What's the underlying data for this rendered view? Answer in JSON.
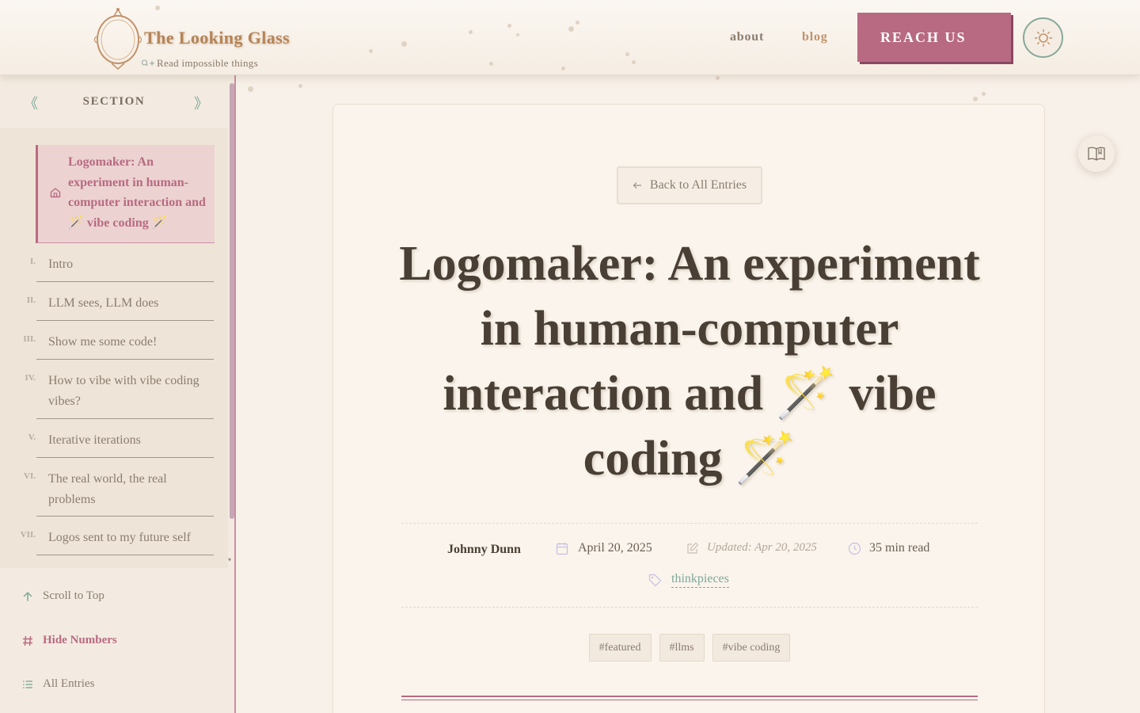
{
  "header": {
    "site_title": "The Looking Glass",
    "tagline": "Read impossible things",
    "nav": [
      {
        "label": "about"
      },
      {
        "label": "blog"
      }
    ],
    "cta_label": "REACH US"
  },
  "sidebar": {
    "title": "SECTION",
    "prev_glyph": "《",
    "next_glyph": "》",
    "active_item": "Logomaker: An experiment in human-computer interaction and 🪄 vibe coding 🪄",
    "toc": [
      {
        "num": "I.",
        "label": "Intro"
      },
      {
        "num": "II.",
        "label": "LLM sees, LLM does"
      },
      {
        "num": "III.",
        "label": "Show me some code!"
      },
      {
        "num": "IV.",
        "label": "How to vibe with vibe coding vibes?"
      },
      {
        "num": "V.",
        "label": "Iterative iterations"
      },
      {
        "num": "VI.",
        "label": "The real world, the real problems"
      },
      {
        "num": "VII.",
        "label": "Logos sent to my future self"
      }
    ],
    "tools": {
      "scroll_top": "Scroll to Top",
      "hide_numbers": "Hide Numbers",
      "all_entries": "All Entries"
    }
  },
  "article": {
    "back_label": "Back to All Entries",
    "title": "Logomaker: An experiment in human-computer interaction and 🪄 vibe coding 🪄",
    "author": "Johnny Dunn",
    "date": "April 20, 2025",
    "updated": "Updated: Apr 20, 2025",
    "read_time": "35 min read",
    "category": "thinkpieces",
    "tags": [
      "#featured",
      "#llms",
      "#vibe coding"
    ]
  },
  "colors": {
    "background": "#f8f1e9",
    "accent_pink": "#b86a82",
    "accent_green": "#7fa79a",
    "title_gold": "#b58457",
    "text": "#4a3f34"
  }
}
